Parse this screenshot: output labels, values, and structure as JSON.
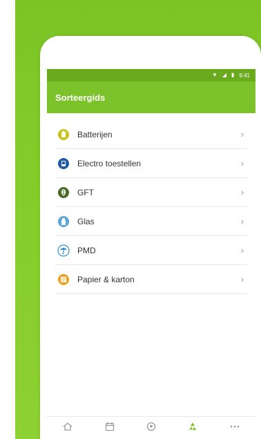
{
  "app": {
    "title": "Sorteergids",
    "accent_color": "#7cc22a",
    "status_bar": {
      "time": "9:41",
      "icons": [
        "wifi-icon",
        "signal-icon",
        "battery-icon"
      ]
    }
  },
  "list": {
    "items": [
      {
        "label": "Batterijen",
        "icon": "battery-category-icon",
        "color": "#c8c21a"
      },
      {
        "label": "Electro toestellen",
        "icon": "electronics-category-icon",
        "color": "#1e5aa8"
      },
      {
        "label": "GFT",
        "icon": "organic-waste-category-icon",
        "color": "#4a6b2a"
      },
      {
        "label": "Glas",
        "icon": "glass-category-icon",
        "color": "#5aa6d8"
      },
      {
        "label": "PMD",
        "icon": "pmd-category-icon",
        "color": "#3a8fd0"
      },
      {
        "label": "Papier & karton",
        "icon": "paper-category-icon",
        "color": "#f0a020"
      }
    ],
    "chevron": "›"
  },
  "bottom_nav": {
    "items": [
      {
        "icon": "home-icon",
        "active": false
      },
      {
        "icon": "calendar-icon",
        "active": false
      },
      {
        "icon": "location-icon",
        "active": false
      },
      {
        "icon": "recycle-icon",
        "active": true
      },
      {
        "icon": "more-icon",
        "active": false
      }
    ]
  }
}
